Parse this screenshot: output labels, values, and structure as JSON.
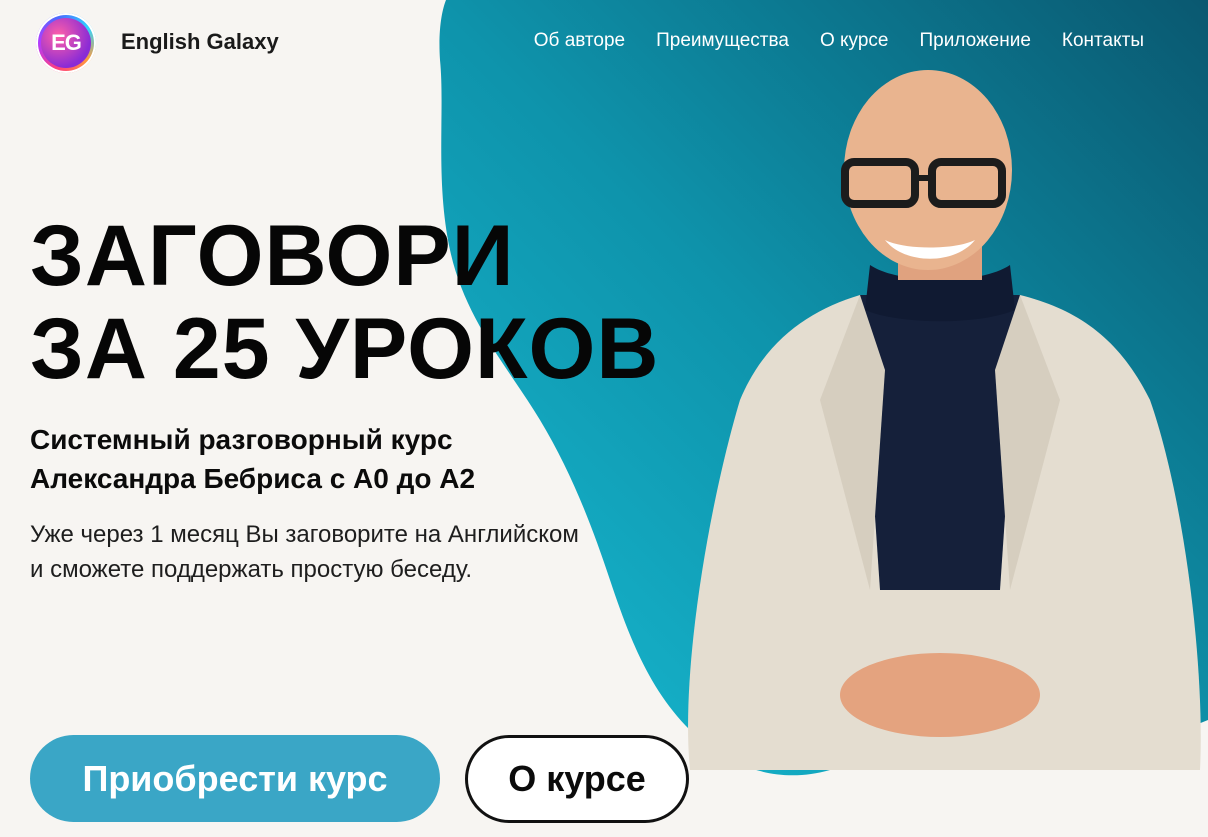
{
  "brand": {
    "logo_text": "EG",
    "name": "English Galaxy"
  },
  "nav": [
    "Об авторе",
    "Преимущества",
    "О курсе",
    "Приложение",
    "Контакты"
  ],
  "hero": {
    "title_line1": "ЗАГОВОРИ",
    "title_line2": "ЗА 25 УРОКОВ",
    "subtitle_line1": "Системный разговорный курс",
    "subtitle_line2": "Александра Бебриса с А0 до А2",
    "description": "Уже через 1 месяц Вы заговорите на Английском и сможете поддержать простую беседу.",
    "buy_button": "Приобрести курс",
    "about_button": "О курсе"
  },
  "colors": {
    "accent": "#3aa6c6",
    "blob_light": "#1ab7cf",
    "blob_dark": "#0a5d74",
    "background": "#f7f5f2"
  }
}
